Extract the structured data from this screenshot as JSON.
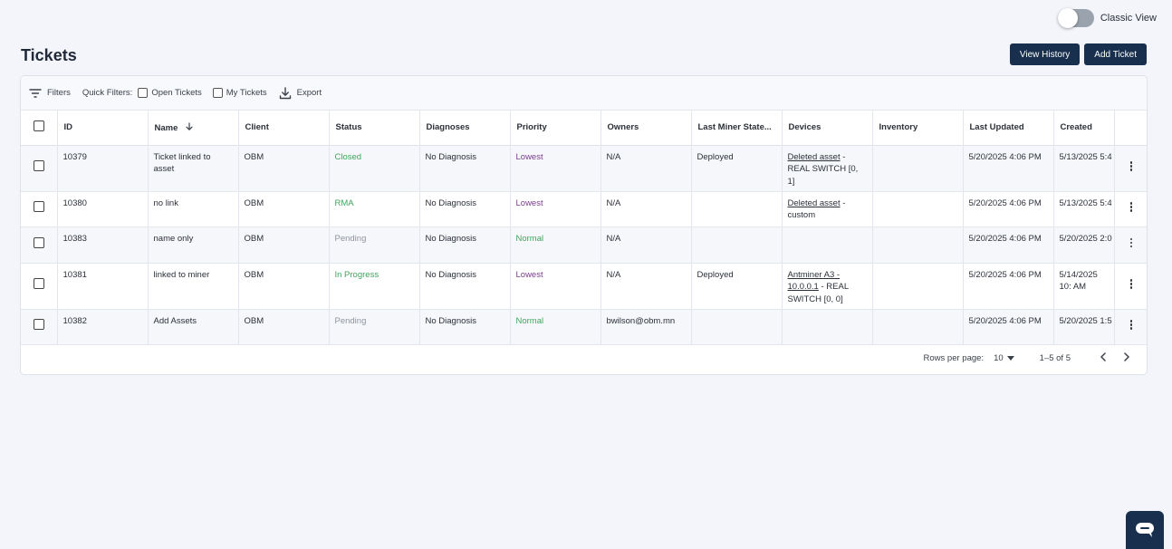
{
  "header": {
    "classic_view_label": "Classic View",
    "page_title": "Tickets",
    "view_history_label": "View History",
    "add_ticket_label": "Add Ticket"
  },
  "toolbar": {
    "filters_label": "Filters",
    "quick_filters_label": "Quick Filters:",
    "open_tickets_label": "Open Tickets",
    "my_tickets_label": "My Tickets",
    "export_label": "Export"
  },
  "table": {
    "columns": [
      "ID",
      "Name",
      "Client",
      "Status",
      "Diagnoses",
      "Priority",
      "Owners",
      "Last Miner State...",
      "Devices",
      "Inventory",
      "Last Updated",
      "Created"
    ],
    "rows": [
      {
        "id": "10379",
        "name": "Ticket linked to asset",
        "client": "OBM",
        "status": "Closed",
        "diagnoses": "No Diagnosis",
        "priority": "Lowest",
        "owners": "N/A",
        "last_miner_state": "Deployed",
        "device_link": "Deleted asset",
        "device_rest": " - REAL SWITCH [0, 1]",
        "inventory": "",
        "last_updated": "5/20/2025 4:06 PM",
        "created": "5/13/2025 5:4"
      },
      {
        "id": "10380",
        "name": "no link",
        "client": "OBM",
        "status": "RMA",
        "diagnoses": "No Diagnosis",
        "priority": "Lowest",
        "owners": "N/A",
        "last_miner_state": "",
        "device_link": "Deleted asset",
        "device_rest": " - custom",
        "inventory": "",
        "last_updated": "5/20/2025 4:06 PM",
        "created": "5/13/2025 5:4"
      },
      {
        "id": "10383",
        "name": "name only",
        "client": "OBM",
        "status": "Pending",
        "diagnoses": "No Diagnosis",
        "priority": "Normal",
        "owners": "N/A",
        "last_miner_state": "",
        "device_link": "",
        "device_rest": "",
        "inventory": "",
        "last_updated": "5/20/2025 4:06 PM",
        "created": "5/20/2025 2:0"
      },
      {
        "id": "10381",
        "name": "linked to miner",
        "client": "OBM",
        "status": "In Progress",
        "diagnoses": "No Diagnosis",
        "priority": "Lowest",
        "owners": "N/A",
        "last_miner_state": "Deployed",
        "device_link": "Antminer A3 - 10.0.0.1",
        "device_rest": " - REAL SWITCH [0, 0]",
        "inventory": "",
        "last_updated": "5/20/2025 4:06 PM",
        "created": "5/14/2025 10: AM"
      },
      {
        "id": "10382",
        "name": "Add Assets",
        "client": "OBM",
        "status": "Pending",
        "diagnoses": "No Diagnosis",
        "priority": "Normal",
        "owners": "bwilson@obm.mn",
        "last_miner_state": "",
        "device_link": "",
        "device_rest": "",
        "inventory": "",
        "last_updated": "5/20/2025 4:06 PM",
        "created": "5/20/2025 1:5"
      }
    ]
  },
  "pagination": {
    "rows_per_page_label": "Rows per page:",
    "rows_per_page_value": "10",
    "range_label": "1–5 of 5"
  },
  "colors": {
    "primary_button": "#18304d",
    "status_green": "#3fa55d",
    "status_grey": "#8f959d",
    "priority_lowest": "#7a3d8f",
    "background": "#f3f5fb"
  },
  "icons": [
    "filter-icon",
    "export-icon",
    "sort-arrow-down-icon",
    "kebab-menu-icon",
    "chevron-left-icon",
    "chevron-right-icon",
    "dropdown-arrow-icon",
    "chat-icon"
  ]
}
